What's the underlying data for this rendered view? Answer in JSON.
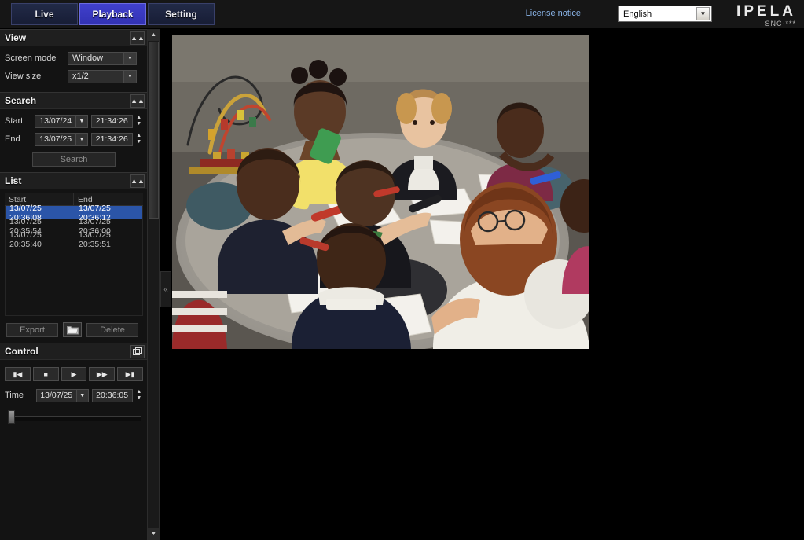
{
  "topbar": {
    "tabs": [
      {
        "label": "Live",
        "active": false
      },
      {
        "label": "Playback",
        "active": true
      },
      {
        "label": "Setting",
        "active": false
      }
    ],
    "license_link": "License notice",
    "language": {
      "value": "English",
      "arrow_icon": "chevron-down-icon"
    },
    "brand": {
      "logo": "IPELA",
      "model": "SNC-***"
    }
  },
  "sidebar": {
    "view_panel": {
      "title": "View",
      "collapse_icon": "double-chevron-up-icon",
      "screen_mode": {
        "label": "Screen mode",
        "value": "Window"
      },
      "view_size": {
        "label": "View size",
        "value": "x1/2"
      }
    },
    "search_panel": {
      "title": "Search",
      "collapse_icon": "double-chevron-up-icon",
      "start": {
        "label": "Start",
        "date": "13/07/24",
        "time": "21:34:26"
      },
      "end": {
        "label": "End",
        "date": "13/07/25",
        "time": "21:34:26"
      },
      "search_button": "Search"
    },
    "list_panel": {
      "title": "List",
      "collapse_icon": "double-chevron-up-icon",
      "columns": [
        "Start",
        "End"
      ],
      "rows": [
        {
          "start": "13/07/25 20:36:08",
          "end": "13/07/25 20:36:12",
          "selected": true
        },
        {
          "start": "13/07/25 20:35:54",
          "end": "13/07/25 20:36:00",
          "selected": false
        },
        {
          "start": "13/07/25 20:35:40",
          "end": "13/07/25 20:35:51",
          "selected": false
        }
      ],
      "export_button": "Export",
      "folder_icon": "folder-icon",
      "delete_button": "Delete"
    },
    "control_panel": {
      "title": "Control",
      "popout_icon": "popout-window-icon",
      "transport": [
        {
          "name": "skip-previous",
          "glyph": "⏮"
        },
        {
          "name": "stop",
          "glyph": "■"
        },
        {
          "name": "play",
          "glyph": "▶"
        },
        {
          "name": "fast-forward",
          "glyph": "▶▶"
        },
        {
          "name": "skip-next",
          "glyph": "⏭"
        }
      ],
      "time": {
        "label": "Time",
        "date": "13/07/25",
        "time": "20:36:05"
      },
      "slider_position_percent": 0
    }
  },
  "collapse_handle": {
    "icon": "double-chevron-left-icon",
    "glyph": "«"
  },
  "scrollbar": {
    "up_glyph": "▲",
    "down_glyph": "▼"
  },
  "video": {
    "name": "playback-video-frame"
  },
  "colors": {
    "accent": "#3232b4",
    "selection": "#2b55a8",
    "link": "#8ab4e8",
    "panel_bg": "#131313"
  }
}
